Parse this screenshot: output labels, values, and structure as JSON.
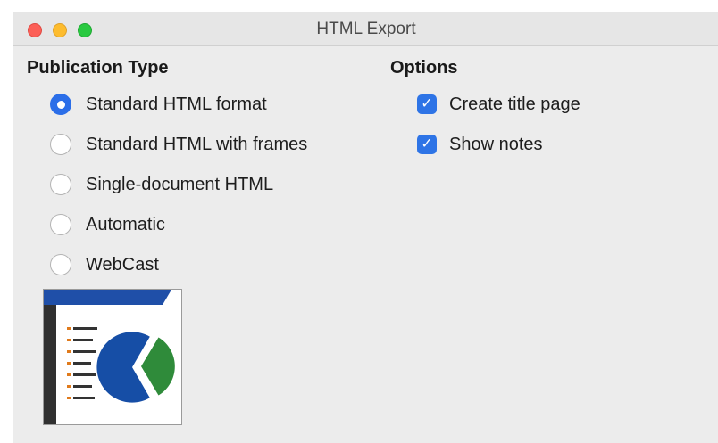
{
  "window": {
    "title": "HTML Export"
  },
  "publication_type": {
    "heading": "Publication Type",
    "options": [
      {
        "label": "Standard HTML format",
        "selected": true
      },
      {
        "label": "Standard HTML with frames",
        "selected": false
      },
      {
        "label": "Single-document HTML",
        "selected": false
      },
      {
        "label": "Automatic",
        "selected": false
      },
      {
        "label": "WebCast",
        "selected": false
      }
    ]
  },
  "options": {
    "heading": "Options",
    "items": [
      {
        "label": "Create title page",
        "checked": true
      },
      {
        "label": "Show notes",
        "checked": true
      }
    ]
  },
  "preview": {
    "icon": "html-export-preview-icon"
  },
  "colors": {
    "accent": "#2b6ee8",
    "preview_header": "#1f4fa8",
    "preview_pie_blue": "#164ea6",
    "preview_pie_green": "#2f8b3a",
    "preview_sidebar": "#303030"
  }
}
